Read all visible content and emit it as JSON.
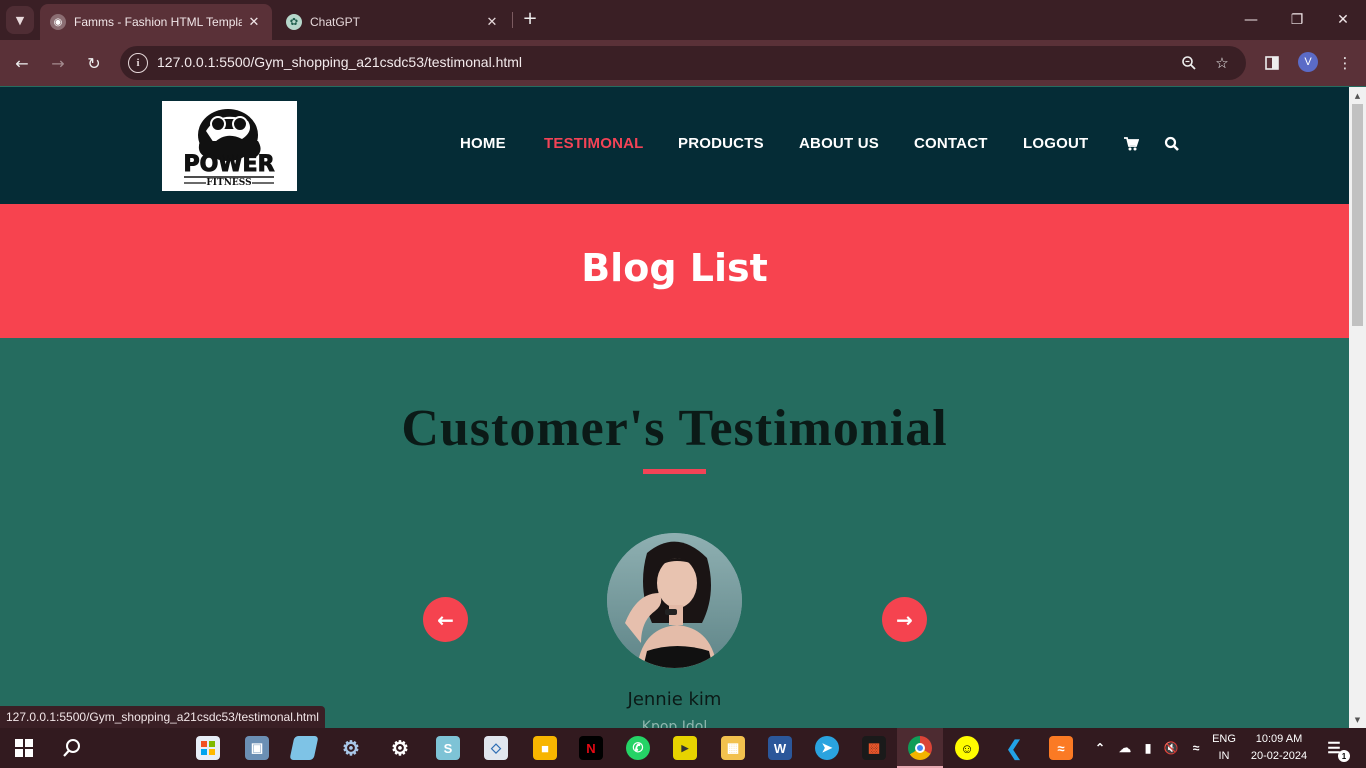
{
  "browser": {
    "tabs": [
      {
        "title": "Famms - Fashion HTML Template",
        "active": true
      },
      {
        "title": "ChatGPT",
        "active": false
      }
    ],
    "url": "127.0.0.1:5500/Gym_shopping_a21csdc53/testimonal.html",
    "profile_initial": "V",
    "status_url": "127.0.0.1:5500/Gym_shopping_a21csdc53/testimonal.html"
  },
  "site": {
    "logo": {
      "main": "POWER",
      "sub": "FITNESS"
    },
    "nav": [
      {
        "label": "HOME",
        "active": false
      },
      {
        "label": "TESTIMONAL",
        "active": true
      },
      {
        "label": "PRODUCTS",
        "active": false
      },
      {
        "label": "ABOUT US",
        "active": false
      },
      {
        "label": "CONTACT",
        "active": false
      },
      {
        "label": "LOGOUT",
        "active": false
      }
    ],
    "hero_title": "Blog List",
    "section_title": "Customer's Testimonial",
    "testimonial": {
      "name": "Jennie kim",
      "role": "Kpop Idol"
    }
  },
  "taskbar": {
    "lang": "ENG",
    "region": "IN",
    "time": "10:09 AM",
    "date": "20-02-2024",
    "notification_count": "1"
  },
  "colors": {
    "accent": "#f34356",
    "header_bg": "#052c36",
    "section_bg": "#256c5f"
  }
}
